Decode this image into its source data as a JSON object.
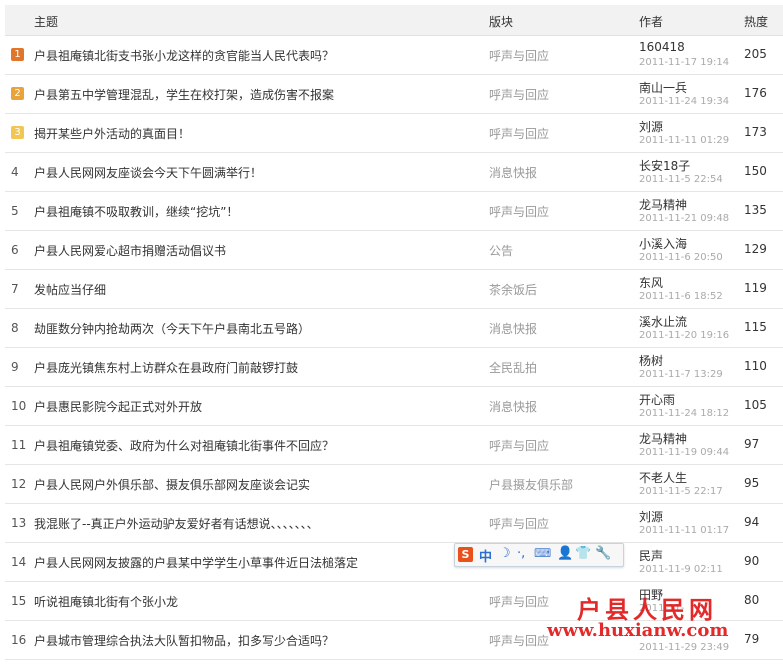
{
  "header": {
    "title": "主题",
    "forum": "版块",
    "author": "作者",
    "heat": "热度"
  },
  "rows": [
    {
      "rank": "1",
      "title": "户县祖庵镇北街支书张小龙这样的贪官能当人民代表吗？",
      "forum": "呼声与回应",
      "author": "160418",
      "date": "2011-11-17 19:14",
      "heat": "205"
    },
    {
      "rank": "2",
      "title": "户县第五中学管理混乱，学生在校打架，造成伤害不报案",
      "forum": "呼声与回应",
      "author": "南山一兵",
      "date": "2011-11-24 19:34",
      "heat": "176"
    },
    {
      "rank": "3",
      "title": "揭开某些户外活动的真面目！",
      "forum": "呼声与回应",
      "author": "刘源",
      "date": "2011-11-11 01:29",
      "heat": "173"
    },
    {
      "rank": "4",
      "title": "户县人民网网友座谈会今天下午圆满举行！",
      "forum": "消息快报",
      "author": "长安18子",
      "date": "2011-11-5 22:54",
      "heat": "150"
    },
    {
      "rank": "5",
      "title": "户县祖庵镇不吸取教训，继续“挖坑”！",
      "forum": "呼声与回应",
      "author": "龙马精神",
      "date": "2011-11-21 09:48",
      "heat": "135"
    },
    {
      "rank": "6",
      "title": "户县人民网爱心超市捐赠活动倡议书",
      "forum": "公告",
      "author": "小溪入海",
      "date": "2011-11-6 20:50",
      "heat": "129"
    },
    {
      "rank": "7",
      "title": "发帖应当仔细",
      "forum": "茶余饭后",
      "author": "东风",
      "date": "2011-11-6 18:52",
      "heat": "119"
    },
    {
      "rank": "8",
      "title": "劫匪数分钟内抢劫两次（今天下午户县南北五号路）",
      "forum": "消息快报",
      "author": "溪水止流",
      "date": "2011-11-20 19:16",
      "heat": "115"
    },
    {
      "rank": "9",
      "title": "户县庞光镇焦东村上访群众在县政府门前敲锣打鼓",
      "forum": "全民乱拍",
      "author": "杨树",
      "date": "2011-11-7 13:29",
      "heat": "110"
    },
    {
      "rank": "10",
      "title": "户县惠民影院今起正式对外开放",
      "forum": "消息快报",
      "author": "开心雨",
      "date": "2011-11-24 18:12",
      "heat": "105"
    },
    {
      "rank": "11",
      "title": "户县祖庵镇党委、政府为什么对祖庵镇北街事件不回应？",
      "forum": "呼声与回应",
      "author": "龙马精神",
      "date": "2011-11-19 09:44",
      "heat": "97"
    },
    {
      "rank": "12",
      "title": "户县人民网户外俱乐部、摄友俱乐部网友座谈会记实",
      "forum": "户县摄友俱乐部",
      "author": "不老人生",
      "date": "2011-11-5 22:17",
      "heat": "95"
    },
    {
      "rank": "13",
      "title": "我混账了--真正户外运动驴友爱好者有话想说、、、、、、、",
      "forum": "呼声与回应",
      "author": "刘源",
      "date": "2011-11-11 01:17",
      "heat": "94"
    },
    {
      "rank": "14",
      "title": "户县人民网网友披露的户县某中学学生小草事件近日法槌落定",
      "forum": "",
      "author": "民声",
      "date": "2011-11-9 02:11",
      "heat": "90"
    },
    {
      "rank": "15",
      "title": "听说祖庵镇北街有个张小龙",
      "forum": "呼声与回应",
      "author": "田野",
      "date": "2011-11-",
      "heat": "80"
    },
    {
      "rank": "16",
      "title": "户县城市管理综合执法大队暂扣物品，扣多写少合适吗？",
      "forum": "呼声与回应",
      "author": "",
      "date": "2011-11-29 23:49",
      "heat": "79"
    }
  ],
  "ime": {
    "logo": "S",
    "mode": "中",
    "moon": "☽",
    "dot": "·,",
    "keyboard": "⌨",
    "user": "👤",
    "skin": "👕",
    "tools": "🔧"
  },
  "watermark": {
    "name": "户县人民网",
    "url": "www.huxianw.com",
    "color": "#e01818"
  },
  "colors": {
    "rank1": "#e0752b",
    "rank2": "#eaa23a",
    "rank3": "#f2c653",
    "header_bg": "#f2f2f2"
  }
}
